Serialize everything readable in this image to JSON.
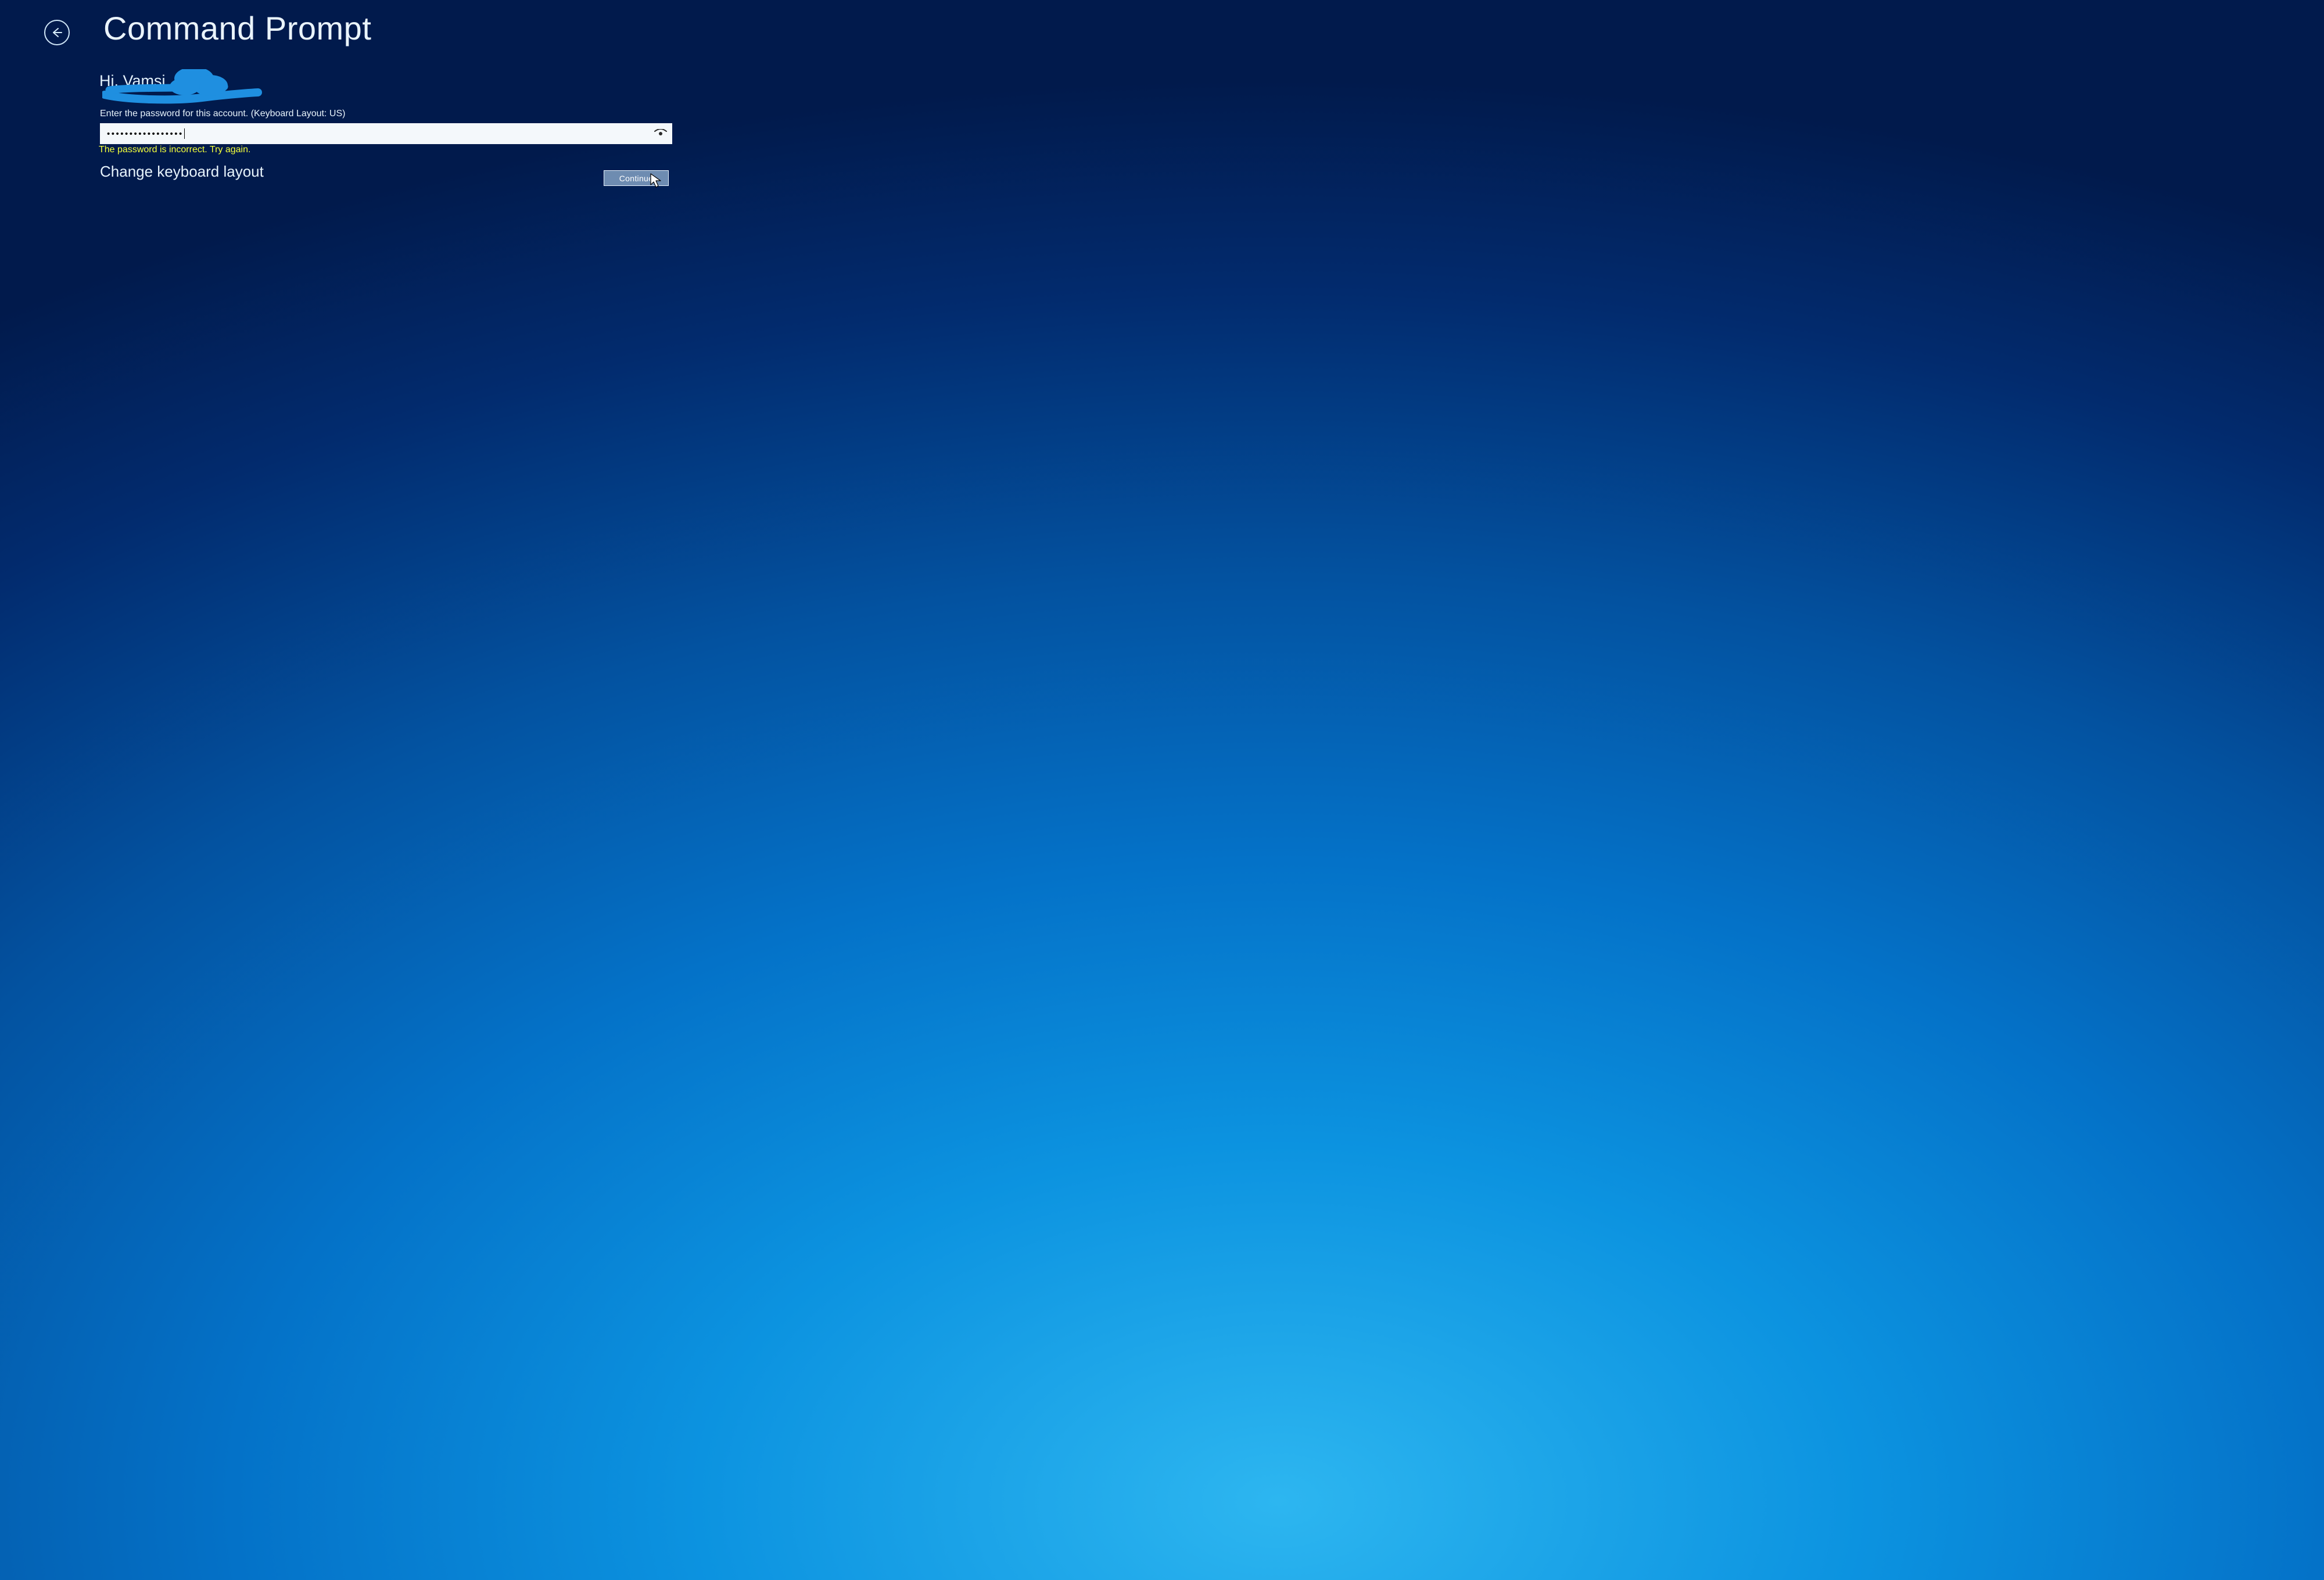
{
  "header": {
    "title": "Command Prompt"
  },
  "greeting": {
    "text": "Hi, Vamsi"
  },
  "prompt": {
    "label": "Enter the password for this account. (Keyboard Layout: US)"
  },
  "password": {
    "masked_value": "•••••••••••••••••",
    "reveal_icon": "eye-icon"
  },
  "error": {
    "message": "The password is incorrect. Try again."
  },
  "links": {
    "change_keyboard": "Change keyboard layout"
  },
  "buttons": {
    "continue_label": "Continue"
  }
}
